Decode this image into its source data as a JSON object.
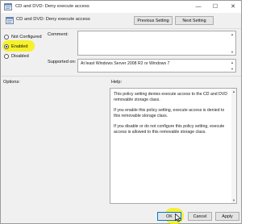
{
  "window": {
    "title": "CD and DVD: Deny execute access",
    "icon": "policy-setting-icon",
    "controls": {
      "minimize": "—",
      "maximize": "☐",
      "close": "✕"
    }
  },
  "header": {
    "title": "CD and DVD: Deny execute access",
    "previous_label": "Previous Setting",
    "next_label": "Next Setting"
  },
  "state": {
    "options": [
      {
        "label": "Not Configured",
        "checked": false
      },
      {
        "label": "Enabled",
        "checked": true
      },
      {
        "label": "Disabled",
        "checked": false
      }
    ]
  },
  "comment": {
    "label": "Comment:",
    "value": ""
  },
  "supported": {
    "label": "Supported on:",
    "value": "At least Windows Server 2008 R2 or Windows 7"
  },
  "options_pane": {
    "label": "Options:"
  },
  "help": {
    "label": "Help:",
    "paragraphs": [
      "This policy setting denies execute access to the CD and DVD removable storage class.",
      "If you enable this policy setting, execute access is denied to this removable storage class.",
      "If you disable or do not configure this policy setting, execute access is allowed to this removable storage class."
    ]
  },
  "footer": {
    "ok_label": "OK",
    "cancel_label": "Cancel",
    "apply_label": "Apply"
  },
  "colors": {
    "highlight": "#f5f01d",
    "window_bg": "#f0f0f0",
    "focus_border": "#0078d7"
  }
}
